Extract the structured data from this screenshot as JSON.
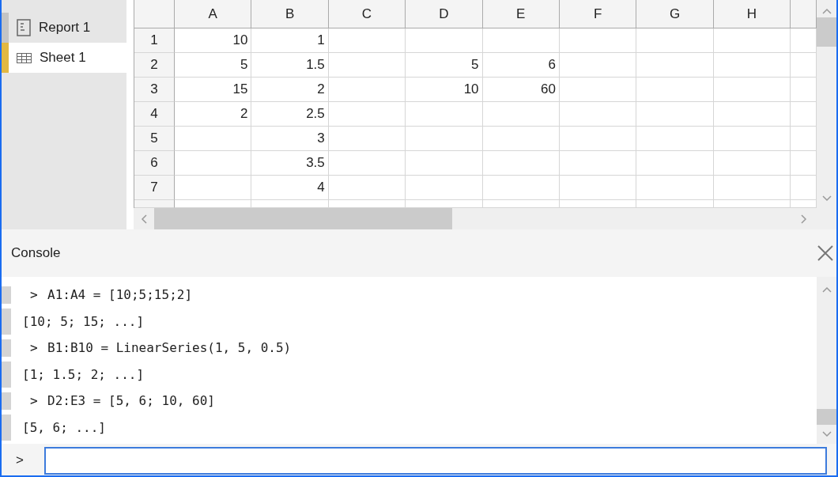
{
  "sidebar": {
    "items": [
      {
        "label": "Report 1",
        "kind": "report",
        "selected": false
      },
      {
        "label": "Sheet 1",
        "kind": "sheet",
        "selected": true
      }
    ]
  },
  "sheet": {
    "columns": [
      "A",
      "B",
      "C",
      "D",
      "E",
      "F",
      "G",
      "H"
    ],
    "rows": [
      {
        "number": "1",
        "cells": [
          "10",
          "1",
          null,
          null,
          null,
          null,
          null,
          null
        ]
      },
      {
        "number": "2",
        "cells": [
          "5",
          "1.5",
          null,
          "5",
          "6",
          null,
          null,
          null
        ]
      },
      {
        "number": "3",
        "cells": [
          "15",
          "2",
          null,
          "10",
          "60",
          null,
          null,
          null
        ]
      },
      {
        "number": "4",
        "cells": [
          "2",
          "2.5",
          null,
          null,
          null,
          null,
          null,
          null
        ]
      },
      {
        "number": "5",
        "cells": [
          null,
          "3",
          null,
          null,
          null,
          null,
          null,
          null
        ]
      },
      {
        "number": "6",
        "cells": [
          null,
          "3.5",
          null,
          null,
          null,
          null,
          null,
          null
        ]
      },
      {
        "number": "7",
        "cells": [
          null,
          "4",
          null,
          null,
          null,
          null,
          null,
          null
        ]
      }
    ]
  },
  "console": {
    "title": "Console",
    "lines": [
      {
        "kind": "input",
        "prompt": ">",
        "text": "A1:A4 = [10;5;15;2]"
      },
      {
        "kind": "output",
        "text": "[10; 5; 15; ...]"
      },
      {
        "kind": "input",
        "prompt": ">",
        "text": "B1:B10 = LinearSeries(1, 5, 0.5)"
      },
      {
        "kind": "output",
        "text": "[1; 1.5; 2; ...]"
      },
      {
        "kind": "input",
        "prompt": ">",
        "text": "D2:E3 = [5, 6; 10, 60]"
      },
      {
        "kind": "output",
        "text": "[5, 6; ...]"
      }
    ],
    "input_prompt": ">"
  }
}
